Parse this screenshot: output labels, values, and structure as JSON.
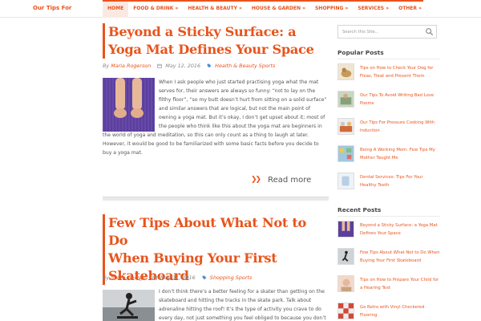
{
  "site": {
    "logo": "Our Tips For"
  },
  "nav": {
    "items": [
      {
        "label": "HOME",
        "active": true
      },
      {
        "label": "FOOD & DRINK »"
      },
      {
        "label": "HEALTH & BEAUTY »"
      },
      {
        "label": "HOUSE & GARDEN »"
      },
      {
        "label": "SHOPPING »"
      },
      {
        "label": "SERVICES »"
      },
      {
        "label": "OTHER »"
      }
    ]
  },
  "posts": [
    {
      "title_line1": "Beyond a Sticky Surface: a",
      "title_line2": "Yoga Mat Defines Your Space",
      "by": "By",
      "author": "Maria Rogerson",
      "date": "May 12, 2016",
      "category": "Health & Beauty Sports",
      "excerpt": "When I ask people who just started practising yoga what the mat serves for, their answers are always so funny: “not to lay on the filthy floor”, “so my butt doesn’t hurt from sitting on a solid surface” and similar answers that are logical, but not the main point of owning a yoga mat. But it’s okay, I don’t get upset about it; most of the people who think like this about the yoga mat are beginners in the world of yoga and meditation, so this can only count as a thing to laugh at later. However, it would be good to be familiarized with some basic facts before you decide to buy a yoga mat.",
      "read_more": "Read more"
    },
    {
      "title_line1": "Few Tips About What Not to Do",
      "title_line2": "When Buying Your First",
      "title_line3": "Skateboard",
      "by": "By",
      "author": "Steve George",
      "date": "May 11, 2016",
      "category": "Shopping Sports",
      "excerpt": "I don’t think there’s a better feeling for a skater than getting on the skateboard and hitting the tracks in the skate park. Talk about adrenaline hitting the roof! It’s the type of activity you crave to do every day, not just something you feel obliged to because you don’t want to"
    }
  ],
  "sidebar": {
    "search_placeholder": "Search this Site...",
    "popular_heading": "Popular Posts",
    "popular": [
      {
        "title": "Tips on How to Check Your Dog for Fleas, Treat and Prevent Them"
      },
      {
        "title": "Our Tips To Avoid Writing Bad Love Poems"
      },
      {
        "title": "Our Tips For Pressure Cooking With Induction"
      },
      {
        "title": "Being A Working Mom: Few Tips My Mother Taught Me"
      },
      {
        "title": "Dental Services: Tips For Your Healthy Teeth"
      }
    ],
    "recent_heading": "Recent Posts",
    "recent": [
      {
        "title": "Beyond a Sticky Surface: a Yoga Mat Defines Your Space"
      },
      {
        "title": "Few Tips About What Not to Do When Buying Your First Skateboard"
      },
      {
        "title": "Tips on How to Prepare Your Child for a Hearing Test"
      },
      {
        "title": "Go Retro with Vinyl Checkered Flooring"
      }
    ]
  },
  "colors": {
    "accent": "#e8541c",
    "text": "#555555"
  }
}
